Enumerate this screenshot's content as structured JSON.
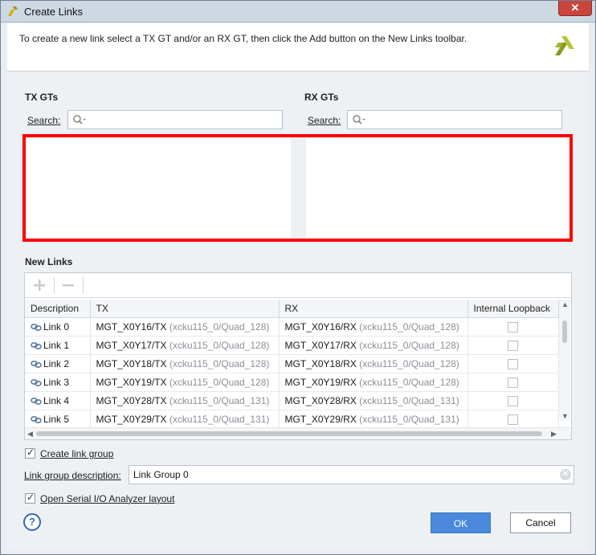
{
  "window": {
    "title": "Create Links",
    "close_label": "✕"
  },
  "banner": {
    "instructions": "To create a new link select a TX GT and/or an RX GT, then click the Add button on the New Links toolbar."
  },
  "tx": {
    "heading": "TX GTs",
    "search_label": "Search:",
    "search_value": ""
  },
  "rx": {
    "heading": "RX GTs",
    "search_label": "Search:",
    "search_value": ""
  },
  "new_links": {
    "heading": "New Links",
    "columns": [
      "Description",
      "TX",
      "RX",
      "Internal Loopback"
    ],
    "rows": [
      {
        "desc": "Link 0",
        "tx": "MGT_X0Y16/TX",
        "tx_loc": "(xcku115_0/Quad_128)",
        "rx": "MGT_X0Y16/RX",
        "rx_loc": "(xcku115_0/Quad_128)",
        "loopback": false
      },
      {
        "desc": "Link 1",
        "tx": "MGT_X0Y17/TX",
        "tx_loc": "(xcku115_0/Quad_128)",
        "rx": "MGT_X0Y17/RX",
        "rx_loc": "(xcku115_0/Quad_128)",
        "loopback": false
      },
      {
        "desc": "Link 2",
        "tx": "MGT_X0Y18/TX",
        "tx_loc": "(xcku115_0/Quad_128)",
        "rx": "MGT_X0Y18/RX",
        "rx_loc": "(xcku115_0/Quad_128)",
        "loopback": false
      },
      {
        "desc": "Link 3",
        "tx": "MGT_X0Y19/TX",
        "tx_loc": "(xcku115_0/Quad_128)",
        "rx": "MGT_X0Y19/RX",
        "rx_loc": "(xcku115_0/Quad_128)",
        "loopback": false
      },
      {
        "desc": "Link 4",
        "tx": "MGT_X0Y28/TX",
        "tx_loc": "(xcku115_0/Quad_131)",
        "rx": "MGT_X0Y28/RX",
        "rx_loc": "(xcku115_0/Quad_131)",
        "loopback": false
      },
      {
        "desc": "Link 5",
        "tx": "MGT_X0Y29/TX",
        "tx_loc": "(xcku115_0/Quad_131)",
        "rx": "MGT_X0Y29/RX",
        "rx_loc": "(xcku115_0/Quad_131)",
        "loopback": false
      }
    ]
  },
  "options": {
    "create_group_label": "Create link group",
    "create_group_checked": true,
    "group_desc_label": "Link group description:",
    "group_desc_value": "Link Group 0",
    "open_layout_label": "Open Serial I/O Analyzer layout",
    "open_layout_checked": true
  },
  "footer": {
    "help_label": "?",
    "ok_label": "OK",
    "cancel_label": "Cancel"
  },
  "colors": {
    "highlight_border": "#ff0000",
    "ok_button": "#4a89dc"
  },
  "icons": [
    "xilinx-logo-icon",
    "search-icon",
    "add-icon",
    "remove-icon",
    "link-icon",
    "clear-icon",
    "help-icon"
  ]
}
